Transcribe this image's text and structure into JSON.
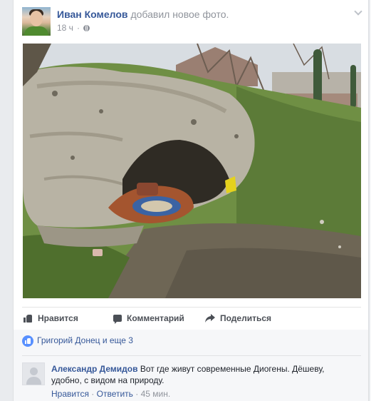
{
  "post": {
    "author": "Иван Комелов",
    "action": "добавил новое фото.",
    "time": "18 ч",
    "privacy_icon": "globe-icon",
    "menu_icon": "chevron-down-icon"
  },
  "photo": {
    "alt_icon": "photo-image"
  },
  "actions": {
    "like_label": "Нравится",
    "comment_label": "Комментарий",
    "share_label": "Поделиться"
  },
  "reactions": {
    "summary": "Григорий Донец и еще 3"
  },
  "comments": [
    {
      "author": "Александр Демидов",
      "text": "Вот где живут современные Диогены. Дёшеву, удобно, с видом на природу.",
      "like_label": "Нравится",
      "separator": " · ",
      "reply_label": "Ответить",
      "time": "45 мин."
    }
  ],
  "colors": {
    "link": "#365899",
    "muted": "#90949c",
    "background": "#e9ebee",
    "like_badge": "#5890ff"
  }
}
